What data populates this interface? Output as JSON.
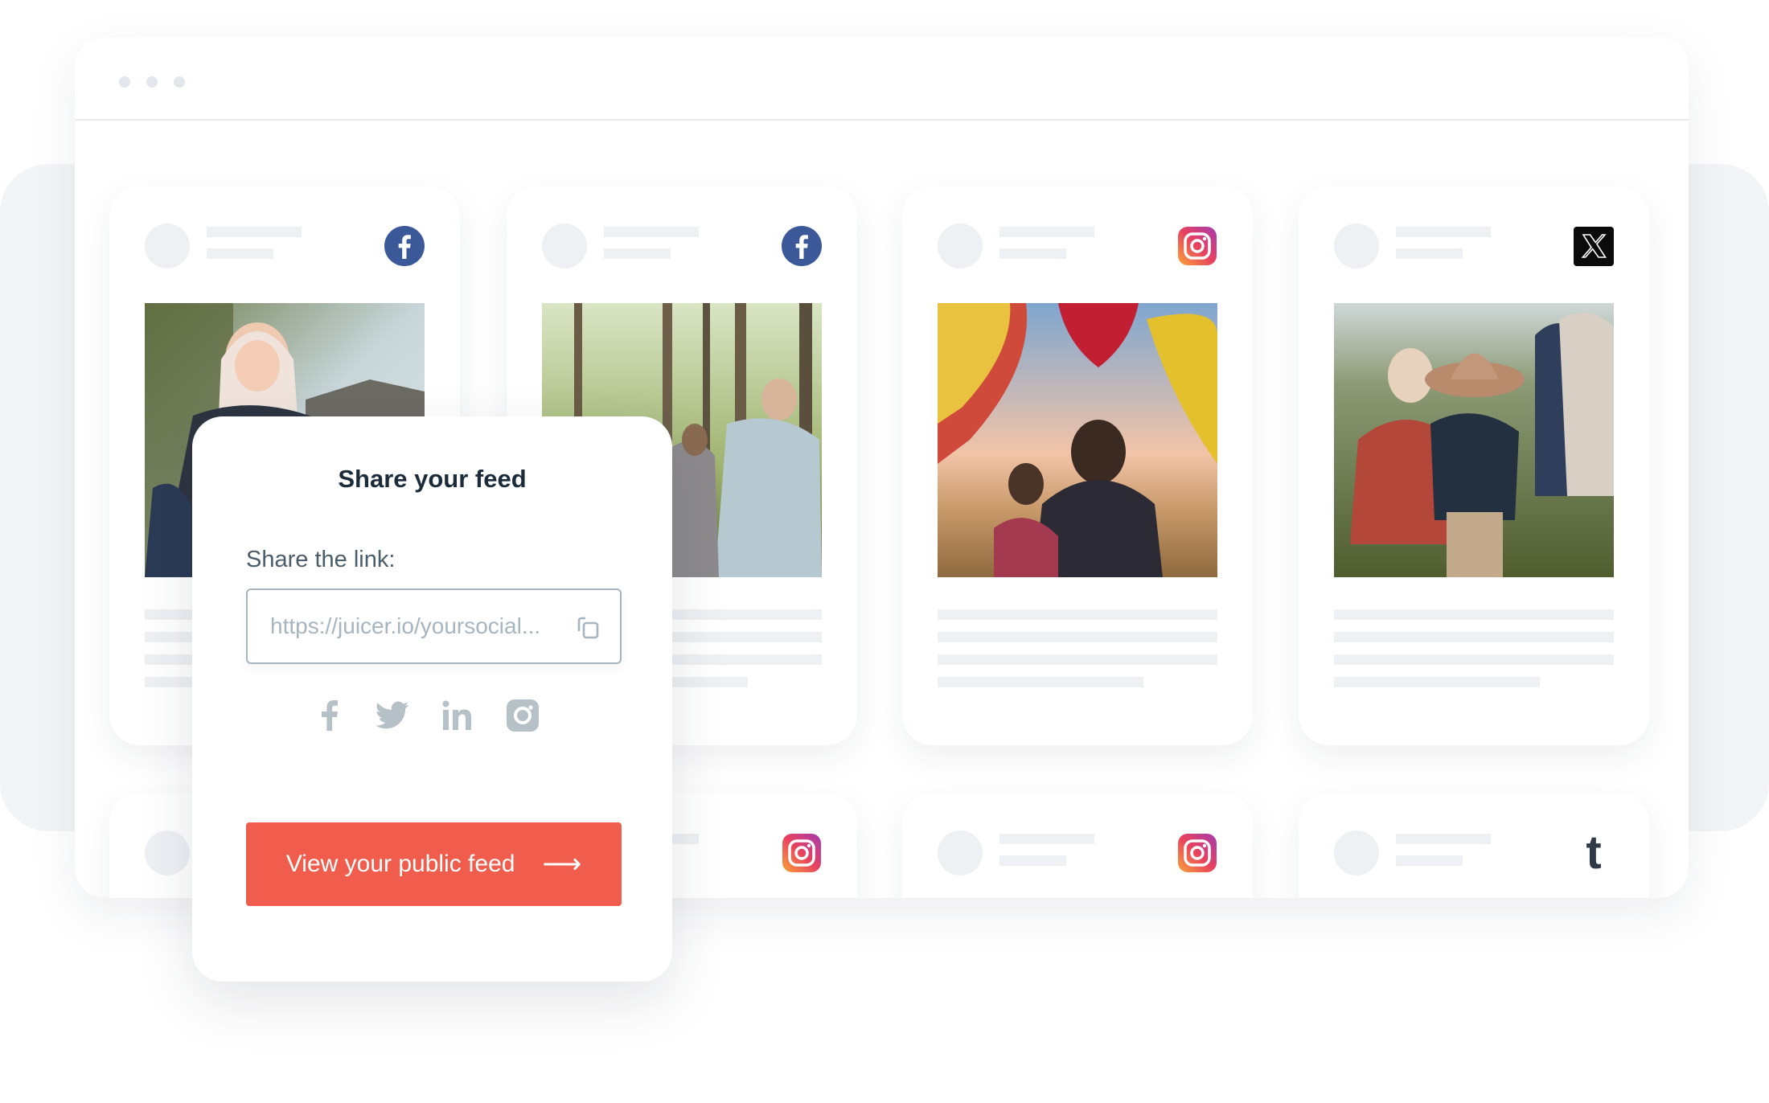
{
  "window": {
    "dots": [
      "dot",
      "dot",
      "dot"
    ]
  },
  "feed": {
    "cards": [
      {
        "network": "facebook",
        "icon": "facebook-icon",
        "photo": "baby-on-shoulders"
      },
      {
        "network": "facebook",
        "icon": "facebook-icon",
        "photo": "family-in-forest"
      },
      {
        "network": "instagram",
        "icon": "instagram-icon",
        "photo": "hot-air-balloons"
      },
      {
        "network": "x",
        "icon": "x-icon",
        "photo": "family-in-field"
      }
    ],
    "row2_cards": [
      {
        "network": "unknown"
      },
      {
        "network": "instagram",
        "icon": "instagram-icon"
      },
      {
        "network": "instagram",
        "icon": "instagram-icon"
      },
      {
        "network": "tumblr",
        "icon": "tumblr-icon",
        "glyph": "t"
      }
    ]
  },
  "modal": {
    "title": "Share your feed",
    "link_label": "Share the link:",
    "link_placeholder": "https://juicer.io/yoursocial...",
    "copy_icon": "copy-icon",
    "share_targets": [
      "facebook",
      "twitter",
      "linkedin",
      "instagram"
    ],
    "cta_label": "View your public feed",
    "cta_arrow": "⟶"
  },
  "colors": {
    "accent": "#f05d4c",
    "facebook": "#3b5998",
    "title": "#1c2b3a",
    "muted_icon": "#b5c0c7",
    "skeleton": "#eef0f4",
    "tumblr": "#2f3a48"
  }
}
